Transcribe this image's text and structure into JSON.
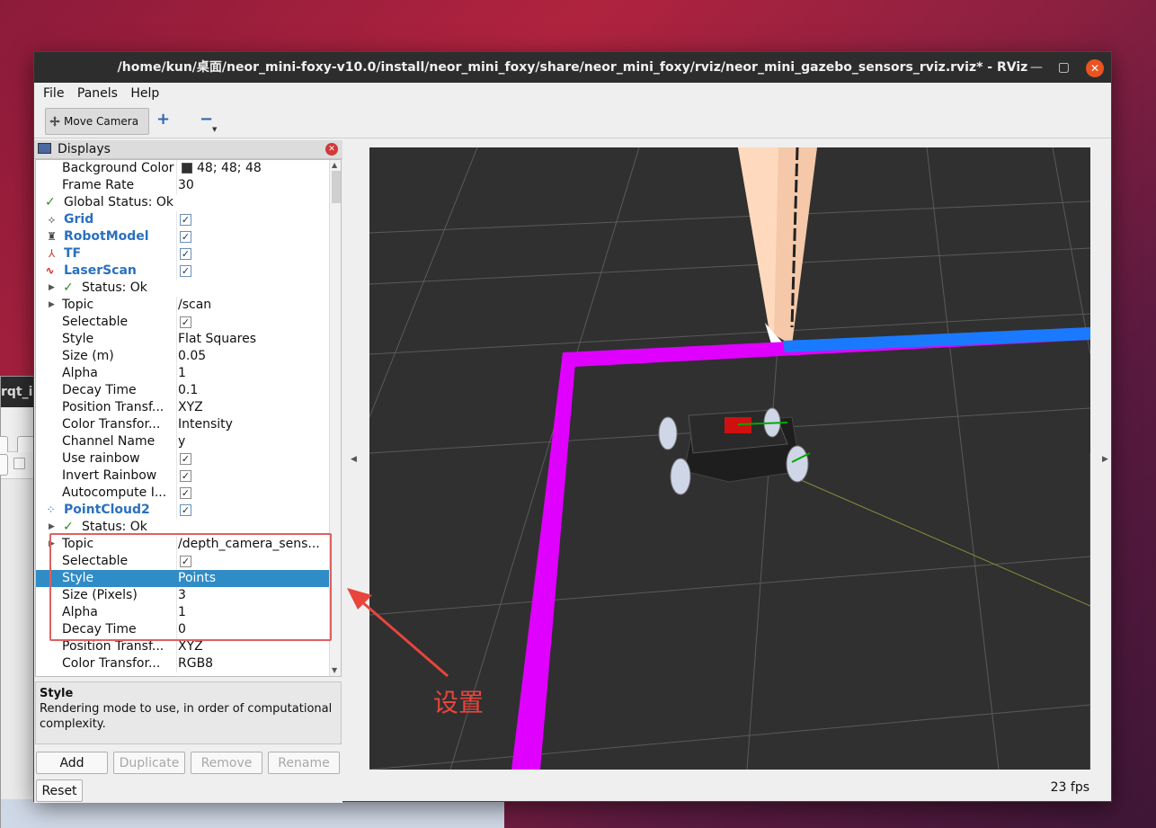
{
  "background_window": {
    "title": "rqt_i"
  },
  "window": {
    "title": "/home/kun/桌面/neor_mini-foxy-v10.0/install/neor_mini_foxy/share/neor_mini_foxy/rviz/neor_mini_gazebo_sensors_rviz.rviz* - RViz"
  },
  "menu": [
    "File",
    "Panels",
    "Help"
  ],
  "toolbar": {
    "move_camera": "Move Camera",
    "plus": "+",
    "minus": "−"
  },
  "displays": {
    "title": "Displays",
    "rows": [
      {
        "key": "Background Color",
        "value": "48; 48; 48"
      },
      {
        "key": "Frame Rate",
        "value": "30"
      },
      {
        "key": "Global Status: Ok"
      },
      {
        "key": "Grid"
      },
      {
        "key": "RobotModel"
      },
      {
        "key": "TF"
      },
      {
        "key": "LaserScan"
      },
      {
        "key": "Status: Ok"
      },
      {
        "key": "Topic",
        "value": "/scan"
      },
      {
        "key": "Selectable"
      },
      {
        "key": "Style",
        "value": "Flat Squares"
      },
      {
        "key": "Size (m)",
        "value": "0.05"
      },
      {
        "key": "Alpha",
        "value": "1"
      },
      {
        "key": "Decay Time",
        "value": "0.1"
      },
      {
        "key": "Position Transf...",
        "value": "XYZ"
      },
      {
        "key": "Color Transfor...",
        "value": "Intensity"
      },
      {
        "key": "Channel Name",
        "value": "y"
      },
      {
        "key": "Use rainbow"
      },
      {
        "key": "Invert Rainbow"
      },
      {
        "key": "Autocompute I..."
      },
      {
        "key": "PointCloud2"
      },
      {
        "key": "Status: Ok"
      },
      {
        "key": "Topic",
        "value": "/depth_camera_sens..."
      },
      {
        "key": "Selectable"
      },
      {
        "key": "Style",
        "value": "Points"
      },
      {
        "key": "Size (Pixels)",
        "value": "3"
      },
      {
        "key": "Alpha",
        "value": "1"
      },
      {
        "key": "Decay Time",
        "value": "0"
      },
      {
        "key": "Position Transf...",
        "value": "XYZ"
      },
      {
        "key": "Color Transfor...",
        "value": "RGB8"
      }
    ]
  },
  "description": {
    "title": "Style",
    "text": "Rendering mode to use, in order of computational complexity."
  },
  "buttons": {
    "add": "Add",
    "duplicate": "Duplicate",
    "remove": "Remove",
    "rename": "Rename",
    "reset": "Reset"
  },
  "status": {
    "fps": "23 fps"
  },
  "annotation": {
    "label": "设置"
  },
  "colors": {
    "viewport_bg": "#303030",
    "selection": "#308cc6",
    "laser_magenta": "#e000ff",
    "laser_blue": "#1a7aff",
    "annotation": "#e8453c"
  }
}
